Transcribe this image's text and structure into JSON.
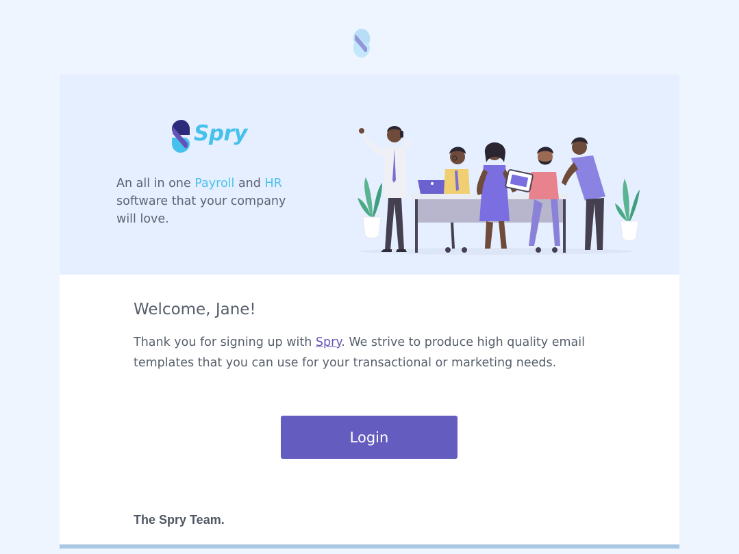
{
  "brand": {
    "name": "Spry",
    "colors": {
      "cyan": "#45c1ec",
      "purple": "#6454b8",
      "navy": "#2c2a7a"
    }
  },
  "hero": {
    "tagline_part1": "An all in one ",
    "tagline_highlight1": "Payroll",
    "tagline_part2": " and ",
    "tagline_highlight2": "HR",
    "tagline_part3": " software that your company will love."
  },
  "content": {
    "welcome": "Welcome, Jane!",
    "body_part1": "Thank you for signing up with ",
    "body_link": "Spry",
    "body_part2": ". We strive to produce high quality email templates that you can use for your transactional or marketing needs."
  },
  "actions": {
    "login_label": "Login",
    "login_color": "#655cc0"
  },
  "footer": {
    "signoff": "The Spry Team."
  }
}
